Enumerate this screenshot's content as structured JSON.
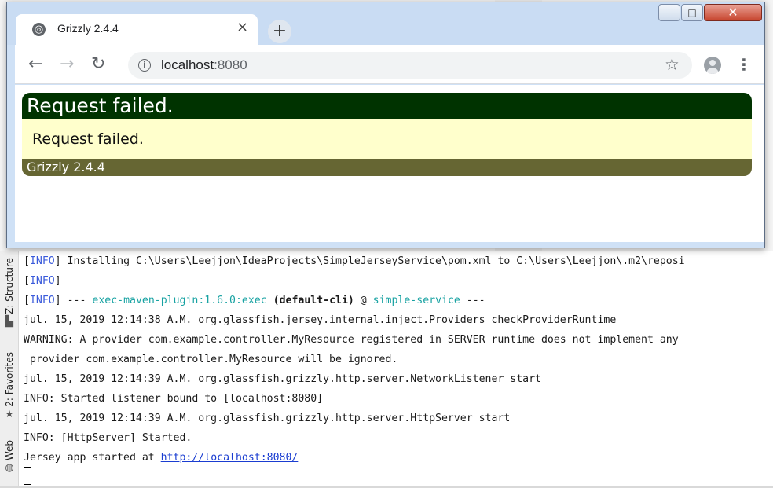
{
  "browser": {
    "tab_title": "Grizzly 2.4.4",
    "new_tab_symbol": "+",
    "close_tab_symbol": "×",
    "address": {
      "host": "localhost",
      "port": ":8080"
    },
    "icons": [
      "globe-icon",
      "back-icon",
      "forward-icon",
      "reload-icon",
      "info-icon",
      "star-icon",
      "avatar-icon",
      "menu-icon"
    ]
  },
  "window_controls": {
    "minimize": "—",
    "maximize": "□",
    "close": "✕"
  },
  "page": {
    "heading": "Request failed.",
    "message": "Request failed.",
    "footer": "Grizzly 2.4.4",
    "colors": {
      "header": "#003300",
      "body": "#ffffcc",
      "footer": "#666633"
    }
  },
  "ide": {
    "side_tabs": [
      {
        "label": "Z: Structure",
        "icon": "structure-icon"
      },
      {
        "label": "2: Favorites",
        "icon": "star-icon"
      },
      {
        "label": "Web",
        "icon": "web-icon"
      }
    ],
    "console": {
      "line1": {
        "tag": "INFO",
        "text": " Installing C:\\Users\\Leejjon\\IdeaProjects\\SimpleJerseyService\\pom.xml to C:\\Users\\Leejjon\\.m2\\reposi"
      },
      "line2": {
        "tag": "INFO"
      },
      "line3": {
        "tag": "INFO",
        "dashes": " --- ",
        "plugin": "exec-maven-plugin:1.6.0:exec",
        "goal": " (default-cli)",
        "at": " @ ",
        "project": "simple-service",
        "end": " ---"
      },
      "line4": "jul. 15, 2019 12:14:38 A.M. org.glassfish.jersey.internal.inject.Providers checkProviderRuntime",
      "line5": "WARNING: A provider com.example.controller.MyResource registered in SERVER runtime does not implement any",
      "line6": " provider com.example.controller.MyResource will be ignored.",
      "line7": "jul. 15, 2019 12:14:39 A.M. org.glassfish.grizzly.http.server.NetworkListener start",
      "line8": "INFO: Started listener bound to [localhost:8080]",
      "line9": "jul. 15, 2019 12:14:39 A.M. org.glassfish.grizzly.http.server.HttpServer start",
      "line10": "INFO: [HttpServer] Started.",
      "line11_prefix": "Jersey app started at ",
      "line11_link": "http://localhost:8080/"
    }
  }
}
